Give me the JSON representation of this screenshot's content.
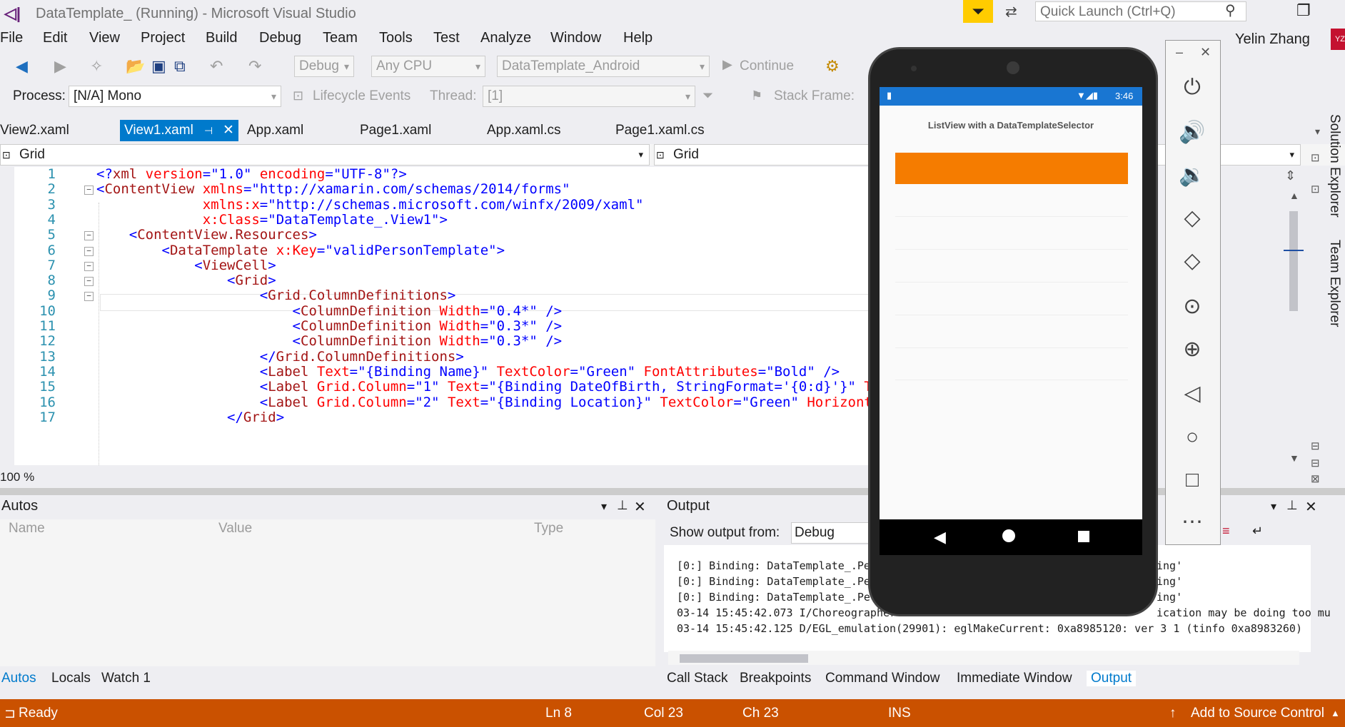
{
  "window": {
    "title": "DataTemplate_ (Running) - Microsoft Visual Studio",
    "quick_launch_placeholder": "Quick Launch (Ctrl+Q)",
    "user_name": "Yelin Zhang",
    "user_initials": "YZ"
  },
  "menu": [
    "File",
    "Edit",
    "View",
    "Project",
    "Build",
    "Debug",
    "Team",
    "Tools",
    "Test",
    "Analyze",
    "Window",
    "Help"
  ],
  "toolbar": {
    "config": "Debug",
    "platform": "Any CPU",
    "startup_project": "DataTemplate_Android",
    "continue_label": "Continue",
    "process_label": "Process:",
    "process_value": "[N/A] Mono",
    "lifecycle_label": "Lifecycle Events",
    "thread_label": "Thread:",
    "thread_value": "[1]",
    "stack_frame_label": "Stack Frame:"
  },
  "tabs": [
    {
      "label": "View2.xaml"
    },
    {
      "label": "View1.xaml"
    },
    {
      "label": "App.xaml"
    },
    {
      "label": "Page1.xaml"
    },
    {
      "label": "App.xaml.cs"
    },
    {
      "label": "Page1.xaml.cs"
    }
  ],
  "navbar": {
    "left": "Grid",
    "right": "Grid"
  },
  "editor": {
    "zoom": "100 %",
    "line_numbers": [
      "1",
      "2",
      "3",
      "4",
      "5",
      "6",
      "7",
      "8",
      "9",
      "10",
      "11",
      "12",
      "13",
      "14",
      "15",
      "16",
      "17"
    ],
    "lines": [
      "<?xml version=\"1.0\" encoding=\"UTF-8\"?>",
      "<ContentView xmlns=\"http://xamarin.com/schemas/2014/forms\"",
      "             xmlns:x=\"http://schemas.microsoft.com/winfx/2009/xaml\"",
      "             x:Class=\"DataTemplate_.View1\">",
      "    <ContentView.Resources>",
      "        <DataTemplate x:Key=\"validPersonTemplate\">",
      "            <ViewCell>",
      "                <Grid>",
      "                    <Grid.ColumnDefinitions>",
      "                        <ColumnDefinition Width=\"0.4*\" />",
      "                        <ColumnDefinition Width=\"0.3*\" />",
      "                        <ColumnDefinition Width=\"0.3*\" />",
      "                    </Grid.ColumnDefinitions>",
      "                    <Label Text=\"{Binding Name}\" TextColor=\"Green\" FontAttributes=\"Bold\" />",
      "                    <Label Grid.Column=\"1\" Text=\"{Binding DateOfBirth, StringFormat='{0:d}'}\" Text",
      "                    <Label Grid.Column=\"2\" Text=\"{Binding Location}\" TextColor=\"Green\" HorizontalT",
      "                </Grid>"
    ]
  },
  "autos": {
    "title": "Autos",
    "columns": [
      "Name",
      "Value",
      "Type"
    ],
    "tabs": [
      "Autos",
      "Locals",
      "Watch 1"
    ]
  },
  "output": {
    "title": "Output",
    "show_from_label": "Show output from:",
    "show_from_value": "Debug",
    "lines": [
      "[0:] Binding: DataTemplate_.Pe",
      "[0:] Binding: DataTemplate_.Pe",
      "[0:] Binding: DataTemplate_.Pe",
      "03-14 15:45:42.073 I/Choreographer",
      "03-14 15:45:42.125 D/EGL_emulation(29901): eglMakeCurrent: 0xa8985120: ver 3 1 (tinfo 0xa8983260)"
    ],
    "tail_fragments": [
      "ing'",
      "ing'",
      "ing'",
      "ication may be doing too mu"
    ],
    "tabs": [
      "Call Stack",
      "Breakpoints",
      "Command Window",
      "Immediate Window",
      "Output"
    ]
  },
  "status": {
    "ready": "Ready",
    "ln": "Ln 8",
    "col": "Col 23",
    "ch": "Ch 23",
    "ins": "INS",
    "source_control": "Add to Source Control"
  },
  "side_tabs": [
    "Solution Explorer",
    "Team Explorer"
  ],
  "phone": {
    "time": "3:46",
    "page_title": "ListView with a DataTemplateSelector",
    "status_color": "#1976d2",
    "row_color": "#f57c00"
  },
  "colors": {
    "accent": "#007acc",
    "statusbar": "#ca5100"
  }
}
